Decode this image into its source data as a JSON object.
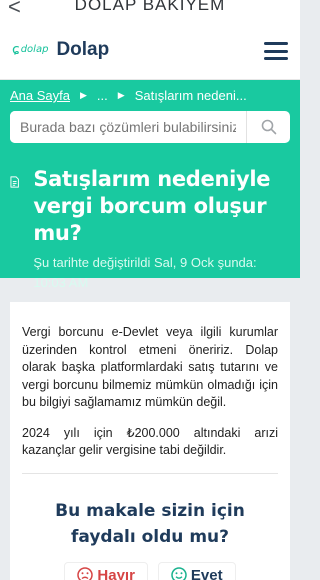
{
  "topbar": {
    "back_glyph": "<",
    "title": "DOLAP BAKIYEM"
  },
  "header": {
    "logo_badge": "dolap",
    "logo_text": "Dolap"
  },
  "breadcrumb": {
    "home": "Ana Sayfa",
    "middle": "...",
    "current": "Satışlarım nedeni..."
  },
  "search": {
    "placeholder": "Burada bazı çözümleri bulabilirsiniz..."
  },
  "article": {
    "title": "Satışlarım nedeniyle vergi borcum oluşur mu?",
    "updated": "Şu tarihte değiştirildi Sal, 9 Ock şunda: 10:03 AM",
    "paragraphs": [
      "Vergi borcunu e-Devlet veya ilgili kurumlar üzerinden kontrol etmeni öneririz. Dolap olarak başka platformlardaki satış tutarını ve vergi borcunu bilmemiz mümkün olmadığı için bu bilgiyi sağlamamız mümkün değil.",
      "2024 yılı için ₺200.000 altındaki arızi kazançlar gelir vergisine tabi değildir."
    ]
  },
  "feedback": {
    "question": "Bu makale sizin için faydalı oldu mu?",
    "no_label": "Hayır",
    "yes_label": "Evet"
  },
  "colors": {
    "brand_green": "#19c9a0",
    "navy": "#1f3b5b",
    "no_red": "#d64545"
  }
}
